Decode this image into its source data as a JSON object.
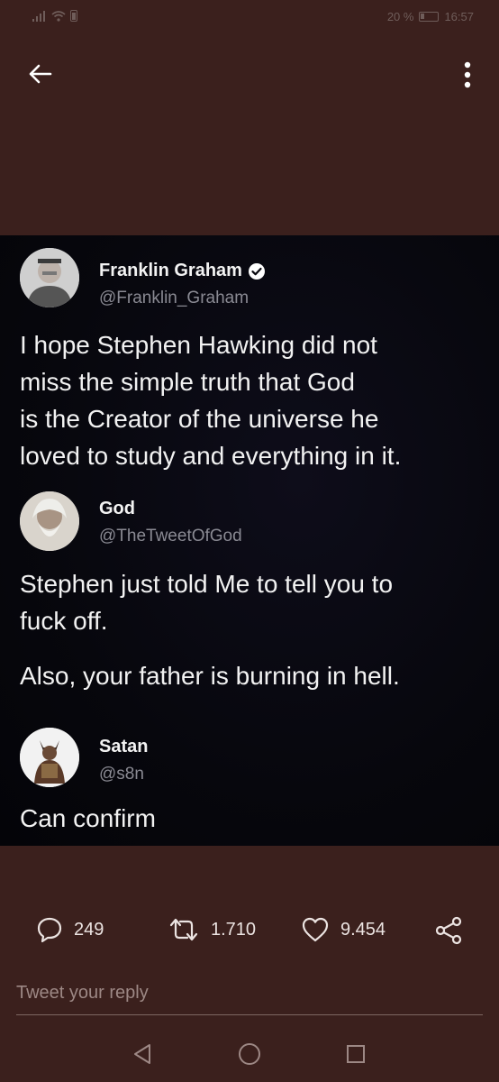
{
  "status_bar": {
    "battery_text": "20 %",
    "time": "16:57"
  },
  "icons": {
    "back": "arrow-left-icon",
    "more": "more-vertical-icon",
    "reply": "comment-icon",
    "retweet": "retweet-icon",
    "like": "heart-icon",
    "share": "share-icon",
    "verified": "verified-badge-icon"
  },
  "tweets": [
    {
      "name": "Franklin Graham",
      "handle": "@Franklin_Graham",
      "verified": true,
      "lines": [
        "I hope Stephen Hawking did not",
        "miss the simple truth that God",
        "is the Creator of the universe he",
        "loved to study and everything in it."
      ]
    },
    {
      "name": "God",
      "handle": "@TheTweetOfGod",
      "lines": [
        "Stephen just told Me to tell you to",
        "fuck off."
      ],
      "lines2": [
        "Also, your father is burning in hell."
      ]
    },
    {
      "name": "Satan",
      "handle": "@s8n",
      "lines": [
        "Can confirm"
      ]
    }
  ],
  "actions": {
    "replies": "249",
    "retweets": "1.710",
    "likes": "9.454"
  },
  "reply_box": {
    "placeholder": "Tweet your reply"
  },
  "colors": {
    "background": "#3b201d",
    "tweet_bg": "#07070d",
    "verified_badge": "#ffffff"
  }
}
